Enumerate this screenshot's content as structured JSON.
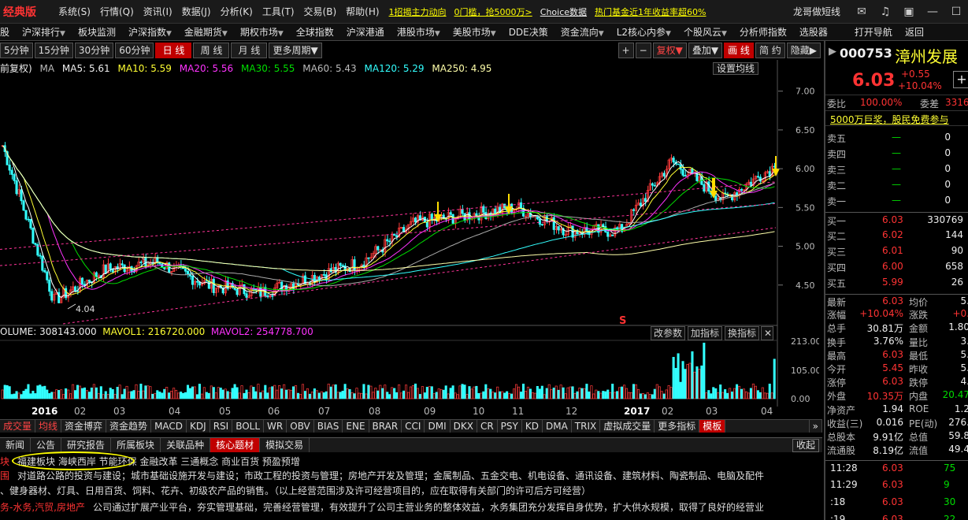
{
  "app": {
    "logo": "经典版",
    "brand": "龙哥做短线"
  },
  "menu": [
    "系统(S)",
    "行情(Q)",
    "资讯(I)",
    "数据(J)",
    "分析(K)",
    "工具(T)",
    "交易(B)",
    "帮助(H)"
  ],
  "news": [
    "1招揭主力动向",
    "0门槛，抢5000万>",
    "Choice数据",
    "热门基金近1年收益率超60%"
  ],
  "nav": [
    "股",
    "沪深排行",
    "板块监测",
    "沪深指数",
    "金融期货",
    "期权市场",
    "全球指数",
    "沪深港通",
    "港股市场",
    "美股市场",
    "DDE决策",
    "资金流向",
    "L2核心内参",
    "个股风云",
    "分析师指数",
    "选股器",
    "打开导航",
    "返回"
  ],
  "periods": [
    "5分钟",
    "15分钟",
    "30分钟",
    "60分钟",
    "日 线",
    "周 线",
    "月 线",
    "更多周期▼"
  ],
  "toolbar": {
    "plus": "+",
    "minus": "−",
    "fq": "复权▼",
    "overlay": "叠加▼",
    "draw": "画 线",
    "simple": "简 约",
    "hide": "隐藏▶"
  },
  "ma": {
    "prefix": "前复权)",
    "label": "MA",
    "ma5": "MA5: 5.61",
    "ma10": "MA10: 5.59",
    "ma20": "MA20: 5.56",
    "ma30": "MA30: 5.55",
    "ma60": "MA60: 5.43",
    "ma120": "MA120: 5.29",
    "ma250": "MA250: 4.95",
    "set": "设置均线"
  },
  "vol": {
    "volume": "OLUME: 308143.000",
    "mavol1": "MAVOL1: 216720.000",
    "mavol2": "MAVOL2: 254778.700"
  },
  "ind_buttons": [
    "改参数",
    "加指标",
    "换指标"
  ],
  "chart": {
    "low_label": "4.04",
    "price_ticks": [
      "7.00",
      "6.50",
      "6.00",
      "5.50",
      "5.00",
      "4.50"
    ],
    "vol_ticks": [
      "213.00",
      "105.00",
      "0.00"
    ],
    "x_labels": [
      "2016",
      "02",
      "03",
      "04",
      "05",
      "06",
      "07",
      "08",
      "09",
      "10",
      "11",
      "12",
      "2017",
      "02",
      "03",
      "04"
    ],
    "marker": "S"
  },
  "chart_data": {
    "type": "candlestick",
    "x": [
      "2016-01",
      "2016-02",
      "2016-03",
      "2016-04",
      "2016-05",
      "2016-06",
      "2016-07",
      "2016-08",
      "2016-09",
      "2016-10",
      "2016-11",
      "2016-12",
      "2017-01",
      "2017-02",
      "2017-03",
      "2017-04"
    ],
    "close": [
      6.3,
      4.3,
      4.7,
      4.8,
      4.5,
      4.4,
      4.6,
      4.8,
      5.3,
      5.4,
      5.5,
      5.2,
      5.2,
      6.1,
      5.6,
      6.03
    ],
    "ylim": [
      4.0,
      7.2
    ],
    "volume_ylim": [
      0,
      213
    ]
  },
  "indicators": [
    "成交量",
    "均线",
    "资金博弈",
    "资金趋势",
    "MACD",
    "KDJ",
    "RSI",
    "BOLL",
    "WR",
    "OBV",
    "BIAS",
    "ENE",
    "BRAR",
    "CCI",
    "DMI",
    "DKX",
    "CR",
    "PSY",
    "KD",
    "DMA",
    "TRIX",
    "虚拟成交量",
    "更多指标",
    "模板"
  ],
  "info_tabs": [
    "新闻",
    "公告",
    "研究报告",
    "所属板块",
    "关联品种",
    "核心题材",
    "模拟交易"
  ],
  "info_collapse": "收起",
  "info": {
    "r1_label": "块",
    "r1_tags": "福建板块  海峡西岸  节能环保  金融改革  三通概念  商业百货  预盈预增",
    "r2_label": "围",
    "r2_text": "对道路公路的投资与建设；城市基础设施开发与建设；市政工程的投资与管理；房地产开发及管理；金属制品、五金交电、机电设备、通讯设备、建筑材料、陶瓷制品、电脑及配件",
    "r3_text": "、健身器材、灯具、日用百货、饲料、花卉、初级农产品的销售。（以上经营范围涉及许可经营项目的，应在取得有关部门的许可后方可经营）",
    "r4_label": "务-水务,汽贸,房地产",
    "r4_text": "公司通过扩展产业平台，夯实管理基础，完善经营管理，有效提升了公司主营业务的整体效益，水务集团充分发挥自身优势，扩大供水规模，取得了良好的经营业"
  },
  "quote": {
    "code": "000753",
    "name": "漳州发展",
    "price": "6.03",
    "change": "+0.55",
    "pct": "+10.04%",
    "wb_label": "委比",
    "wb": "100.00%",
    "wc_label": "委差",
    "wc": "3316",
    "promo": "5000万巨奖，股民免费参与",
    "sell": [
      {
        "l": "卖五",
        "p": "—",
        "v": "0"
      },
      {
        "l": "卖四",
        "p": "—",
        "v": "0"
      },
      {
        "l": "卖三",
        "p": "—",
        "v": "0"
      },
      {
        "l": "卖二",
        "p": "—",
        "v": "0"
      },
      {
        "l": "卖一",
        "p": "—",
        "v": "0"
      }
    ],
    "buy": [
      {
        "l": "买一",
        "p": "6.03",
        "v": "330769"
      },
      {
        "l": "买二",
        "p": "6.02",
        "v": "144"
      },
      {
        "l": "买三",
        "p": "6.01",
        "v": "90"
      },
      {
        "l": "买四",
        "p": "6.00",
        "v": "658"
      },
      {
        "l": "买五",
        "p": "5.99",
        "v": "26"
      }
    ],
    "stats": [
      {
        "a": "最新",
        "av": "6.03",
        "b": "均价",
        "bv": "5."
      },
      {
        "a": "涨幅",
        "av": "+10.04%",
        "b": "涨跌",
        "bv": "+0."
      },
      {
        "a": "总手",
        "av": "30.81万",
        "b": "金额",
        "bv": "1.80"
      },
      {
        "a": "换手",
        "av": "3.76%",
        "b": "量比",
        "bv": "3."
      },
      {
        "a": "最高",
        "av": "6.03",
        "b": "最低",
        "bv": "5."
      },
      {
        "a": "今开",
        "av": "5.45",
        "b": "昨收",
        "bv": "5."
      },
      {
        "a": "涨停",
        "av": "6.03",
        "b": "跌停",
        "bv": "4."
      },
      {
        "a": "外盘",
        "av": "10.35万",
        "b": "内盘",
        "bv": "20.47"
      },
      {
        "a": "净资产",
        "av": "1.94",
        "b": "ROE",
        "bv": "1.2"
      },
      {
        "a": "收益(三)",
        "av": "0.016",
        "b": "PE(动)",
        "bv": "276."
      },
      {
        "a": "总股本",
        "av": "9.91亿",
        "b": "总值",
        "bv": "59.8"
      },
      {
        "a": "流通股",
        "av": "8.19亿",
        "b": "流值",
        "bv": "49.4"
      }
    ],
    "ticks": [
      {
        "t": "11:28",
        "p": "6.03",
        "v": "75"
      },
      {
        "t": "11:29",
        "p": "6.03",
        "v": "9"
      },
      {
        "t": ":18",
        "p": "6.03",
        "v": "30"
      },
      {
        "t": ":19",
        "p": "6.03",
        "v": "22"
      }
    ]
  }
}
